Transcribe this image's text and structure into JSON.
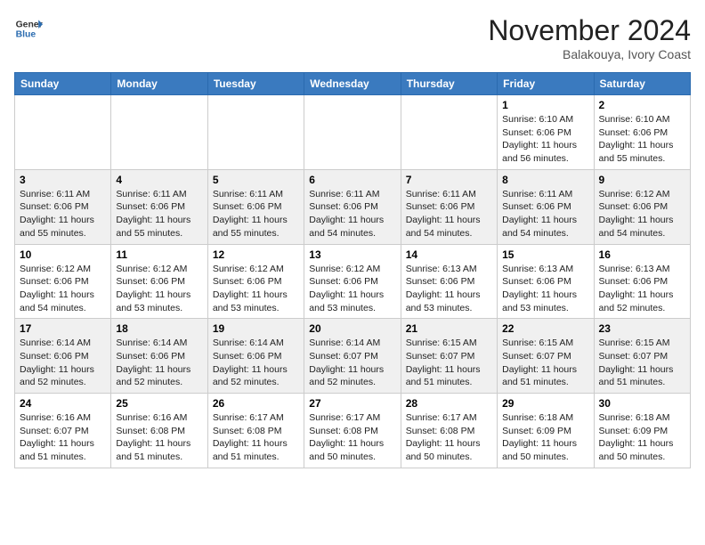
{
  "header": {
    "logo_general": "General",
    "logo_blue": "Blue",
    "month_title": "November 2024",
    "location": "Balakouya, Ivory Coast"
  },
  "weekdays": [
    "Sunday",
    "Monday",
    "Tuesday",
    "Wednesday",
    "Thursday",
    "Friday",
    "Saturday"
  ],
  "weeks": [
    [
      {
        "day": "",
        "info": ""
      },
      {
        "day": "",
        "info": ""
      },
      {
        "day": "",
        "info": ""
      },
      {
        "day": "",
        "info": ""
      },
      {
        "day": "",
        "info": ""
      },
      {
        "day": "1",
        "info": "Sunrise: 6:10 AM\nSunset: 6:06 PM\nDaylight: 11 hours and 56 minutes."
      },
      {
        "day": "2",
        "info": "Sunrise: 6:10 AM\nSunset: 6:06 PM\nDaylight: 11 hours and 55 minutes."
      }
    ],
    [
      {
        "day": "3",
        "info": "Sunrise: 6:11 AM\nSunset: 6:06 PM\nDaylight: 11 hours and 55 minutes."
      },
      {
        "day": "4",
        "info": "Sunrise: 6:11 AM\nSunset: 6:06 PM\nDaylight: 11 hours and 55 minutes."
      },
      {
        "day": "5",
        "info": "Sunrise: 6:11 AM\nSunset: 6:06 PM\nDaylight: 11 hours and 55 minutes."
      },
      {
        "day": "6",
        "info": "Sunrise: 6:11 AM\nSunset: 6:06 PM\nDaylight: 11 hours and 54 minutes."
      },
      {
        "day": "7",
        "info": "Sunrise: 6:11 AM\nSunset: 6:06 PM\nDaylight: 11 hours and 54 minutes."
      },
      {
        "day": "8",
        "info": "Sunrise: 6:11 AM\nSunset: 6:06 PM\nDaylight: 11 hours and 54 minutes."
      },
      {
        "day": "9",
        "info": "Sunrise: 6:12 AM\nSunset: 6:06 PM\nDaylight: 11 hours and 54 minutes."
      }
    ],
    [
      {
        "day": "10",
        "info": "Sunrise: 6:12 AM\nSunset: 6:06 PM\nDaylight: 11 hours and 54 minutes."
      },
      {
        "day": "11",
        "info": "Sunrise: 6:12 AM\nSunset: 6:06 PM\nDaylight: 11 hours and 53 minutes."
      },
      {
        "day": "12",
        "info": "Sunrise: 6:12 AM\nSunset: 6:06 PM\nDaylight: 11 hours and 53 minutes."
      },
      {
        "day": "13",
        "info": "Sunrise: 6:12 AM\nSunset: 6:06 PM\nDaylight: 11 hours and 53 minutes."
      },
      {
        "day": "14",
        "info": "Sunrise: 6:13 AM\nSunset: 6:06 PM\nDaylight: 11 hours and 53 minutes."
      },
      {
        "day": "15",
        "info": "Sunrise: 6:13 AM\nSunset: 6:06 PM\nDaylight: 11 hours and 53 minutes."
      },
      {
        "day": "16",
        "info": "Sunrise: 6:13 AM\nSunset: 6:06 PM\nDaylight: 11 hours and 52 minutes."
      }
    ],
    [
      {
        "day": "17",
        "info": "Sunrise: 6:14 AM\nSunset: 6:06 PM\nDaylight: 11 hours and 52 minutes."
      },
      {
        "day": "18",
        "info": "Sunrise: 6:14 AM\nSunset: 6:06 PM\nDaylight: 11 hours and 52 minutes."
      },
      {
        "day": "19",
        "info": "Sunrise: 6:14 AM\nSunset: 6:06 PM\nDaylight: 11 hours and 52 minutes."
      },
      {
        "day": "20",
        "info": "Sunrise: 6:14 AM\nSunset: 6:07 PM\nDaylight: 11 hours and 52 minutes."
      },
      {
        "day": "21",
        "info": "Sunrise: 6:15 AM\nSunset: 6:07 PM\nDaylight: 11 hours and 51 minutes."
      },
      {
        "day": "22",
        "info": "Sunrise: 6:15 AM\nSunset: 6:07 PM\nDaylight: 11 hours and 51 minutes."
      },
      {
        "day": "23",
        "info": "Sunrise: 6:15 AM\nSunset: 6:07 PM\nDaylight: 11 hours and 51 minutes."
      }
    ],
    [
      {
        "day": "24",
        "info": "Sunrise: 6:16 AM\nSunset: 6:07 PM\nDaylight: 11 hours and 51 minutes."
      },
      {
        "day": "25",
        "info": "Sunrise: 6:16 AM\nSunset: 6:08 PM\nDaylight: 11 hours and 51 minutes."
      },
      {
        "day": "26",
        "info": "Sunrise: 6:17 AM\nSunset: 6:08 PM\nDaylight: 11 hours and 51 minutes."
      },
      {
        "day": "27",
        "info": "Sunrise: 6:17 AM\nSunset: 6:08 PM\nDaylight: 11 hours and 50 minutes."
      },
      {
        "day": "28",
        "info": "Sunrise: 6:17 AM\nSunset: 6:08 PM\nDaylight: 11 hours and 50 minutes."
      },
      {
        "day": "29",
        "info": "Sunrise: 6:18 AM\nSunset: 6:09 PM\nDaylight: 11 hours and 50 minutes."
      },
      {
        "day": "30",
        "info": "Sunrise: 6:18 AM\nSunset: 6:09 PM\nDaylight: 11 hours and 50 minutes."
      }
    ]
  ]
}
